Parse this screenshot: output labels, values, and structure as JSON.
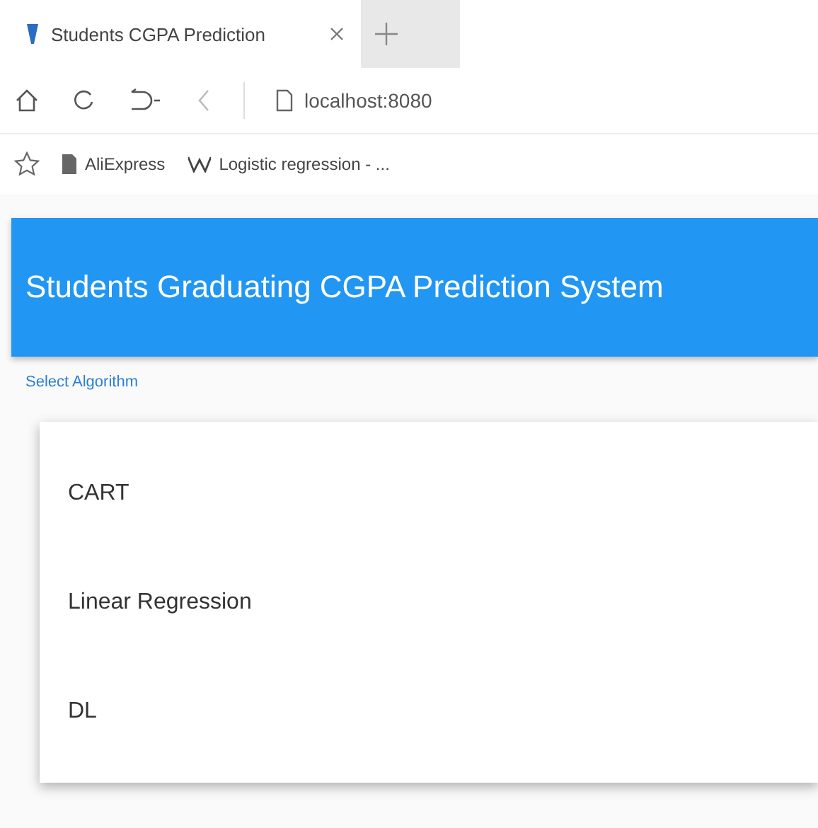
{
  "browser": {
    "tab_title": "Students CGPA Prediction",
    "url": "localhost:8080",
    "bookmarks": [
      {
        "label": "AliExpress",
        "kind": "page"
      },
      {
        "label": "Logistic regression - ...",
        "kind": "wiki"
      }
    ]
  },
  "header": {
    "title": "Students Graduating CGPA Prediction System"
  },
  "select": {
    "label": "Select Algorithm",
    "options": [
      "CART",
      "Linear Regression",
      "DL"
    ]
  }
}
